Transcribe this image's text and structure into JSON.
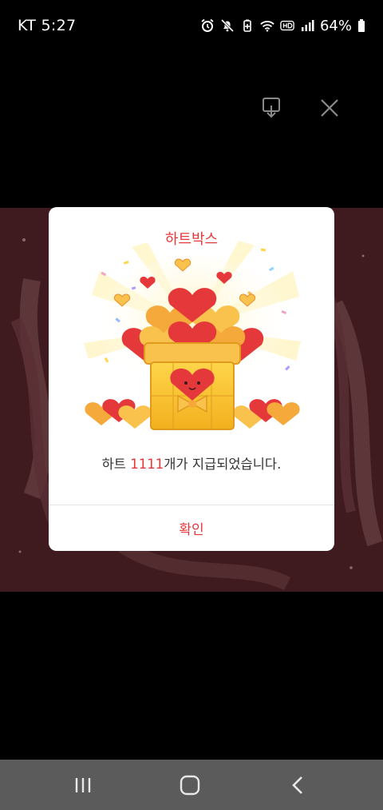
{
  "status_bar": {
    "carrier": "KT",
    "time": "5:27",
    "battery_percent": "64%",
    "icons": [
      "alarm-icon",
      "mute-icon",
      "battery-saver-icon",
      "wifi-icon",
      "hd-icon",
      "signal-icon",
      "battery-icon"
    ]
  },
  "top_actions": {
    "download_icon": "download-icon",
    "close_icon": "close-icon"
  },
  "dialog": {
    "title": "하트박스",
    "message_prefix": "하트 ",
    "heart_count": "1111",
    "message_suffix": "개가 지급되었습니다.",
    "confirm_label": "확인",
    "illustration": "heart-gift-box-illustration",
    "accent_color": "#e5383b"
  },
  "nav_bar": {
    "recents_icon": "recents-icon",
    "home_icon": "home-icon",
    "back_icon": "back-icon"
  }
}
